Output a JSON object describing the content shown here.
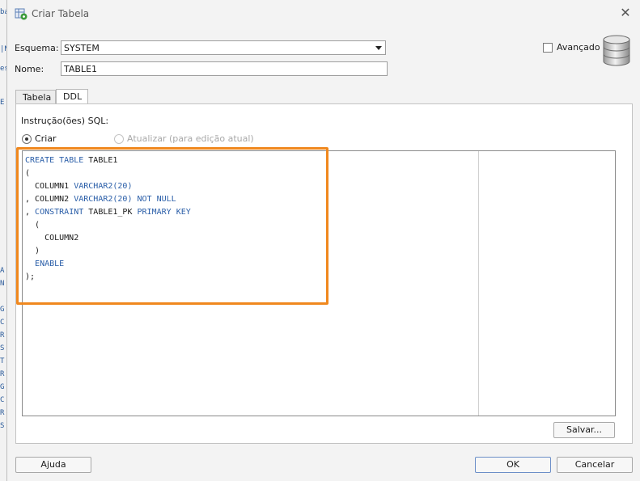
{
  "window": {
    "title": "Criar Tabela"
  },
  "background_chars": [
    "ba",
    "|N",
    "es",
    "E",
    "A",
    "N",
    "G",
    "C",
    "R",
    "S",
    "T",
    "R",
    "G",
    "C",
    "R",
    "S"
  ],
  "form": {
    "schema_label": "Esquema:",
    "schema_value": "SYSTEM",
    "name_label": "Nome:",
    "name_value": "TABLE1",
    "advanced_label": "Avançado",
    "advanced_checked": false
  },
  "tabs": [
    {
      "label": "Tabela",
      "active": false
    },
    {
      "label": "DDL",
      "active": true
    }
  ],
  "ddl": {
    "sql_label": "Instrução(ões) SQL:",
    "radio_create": "Criar",
    "radio_update": "Atualizar (para edição atual)",
    "code_lines": [
      "CREATE TABLE TABLE1",
      "(",
      "  COLUMN1 VARCHAR2(20)",
      ", COLUMN2 VARCHAR2(20) NOT NULL",
      ", CONSTRAINT TABLE1_PK PRIMARY KEY",
      "  (",
      "    COLUMN2",
      "  )",
      "  ENABLE",
      ");"
    ],
    "keywords": [
      "CREATE",
      "TABLE",
      "VARCHAR2",
      "NOT",
      "NULL",
      "CONSTRAINT",
      "PRIMARY",
      "KEY",
      "ENABLE"
    ],
    "save_button": "Salvar..."
  },
  "footer": {
    "help_button": "Ajuda",
    "ok_button": "OK",
    "cancel_button": "Cancelar"
  },
  "colors": {
    "keyword": "#2a5ea8",
    "highlight_border": "#f0881e",
    "dialog_bg": "#f3f3f3"
  }
}
